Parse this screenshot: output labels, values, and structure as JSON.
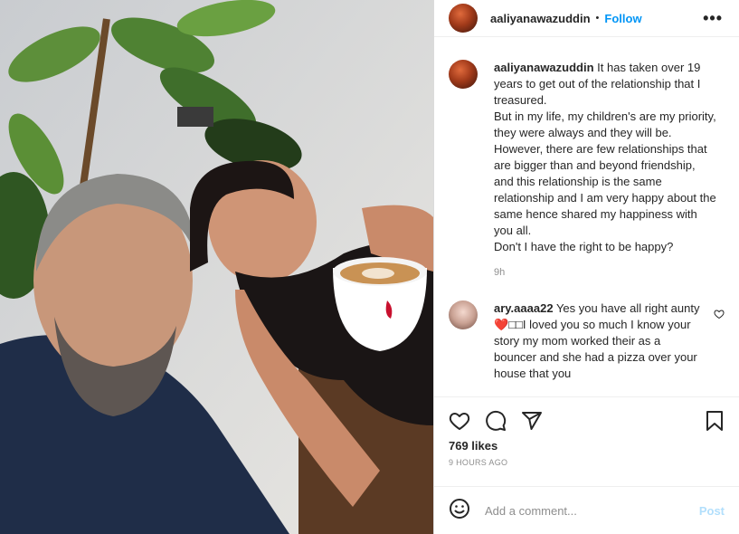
{
  "header": {
    "username": "aaliyanawazuddin",
    "separator": "•",
    "follow_label": "Follow",
    "more_label": "•••",
    "avatar_icon": "profile-avatar"
  },
  "caption": {
    "username": "aaliyanawazuddin",
    "lines": [
      "It has taken over 19 years to get out of the relationship that I treasured.",
      "But in my life, my children's are my priority, they were always and they will be.",
      "However, there are few relationships that are bigger than and beyond friendship, and this relationship is the same relationship and I am very happy about the same hence shared my happiness with you all.",
      "Don't I have the right to be happy?"
    ],
    "time": "9h"
  },
  "comment": {
    "username": "ary.aaaa22",
    "text_before_emoji": "Yes you have all right aunty",
    "emoji": "❤️",
    "text_after_emoji": "□□I loved you so much I know your story my mom worked their as a bouncer and she had a pizza over your house that you"
  },
  "actions": {
    "likes": "769 likes",
    "timestamp": "9 HOURS AGO",
    "icons": [
      "heart-icon",
      "comment-icon",
      "share-icon",
      "bookmark-icon"
    ]
  },
  "add_comment": {
    "placeholder": "Add a comment...",
    "post_label": "Post",
    "emoji_icon": "smiley-icon"
  },
  "colors": {
    "accent": "#0095f6",
    "post_disabled": "#b2dffc",
    "text": "#262626",
    "muted": "#8e8e8e",
    "like_red": "#ed4956"
  }
}
